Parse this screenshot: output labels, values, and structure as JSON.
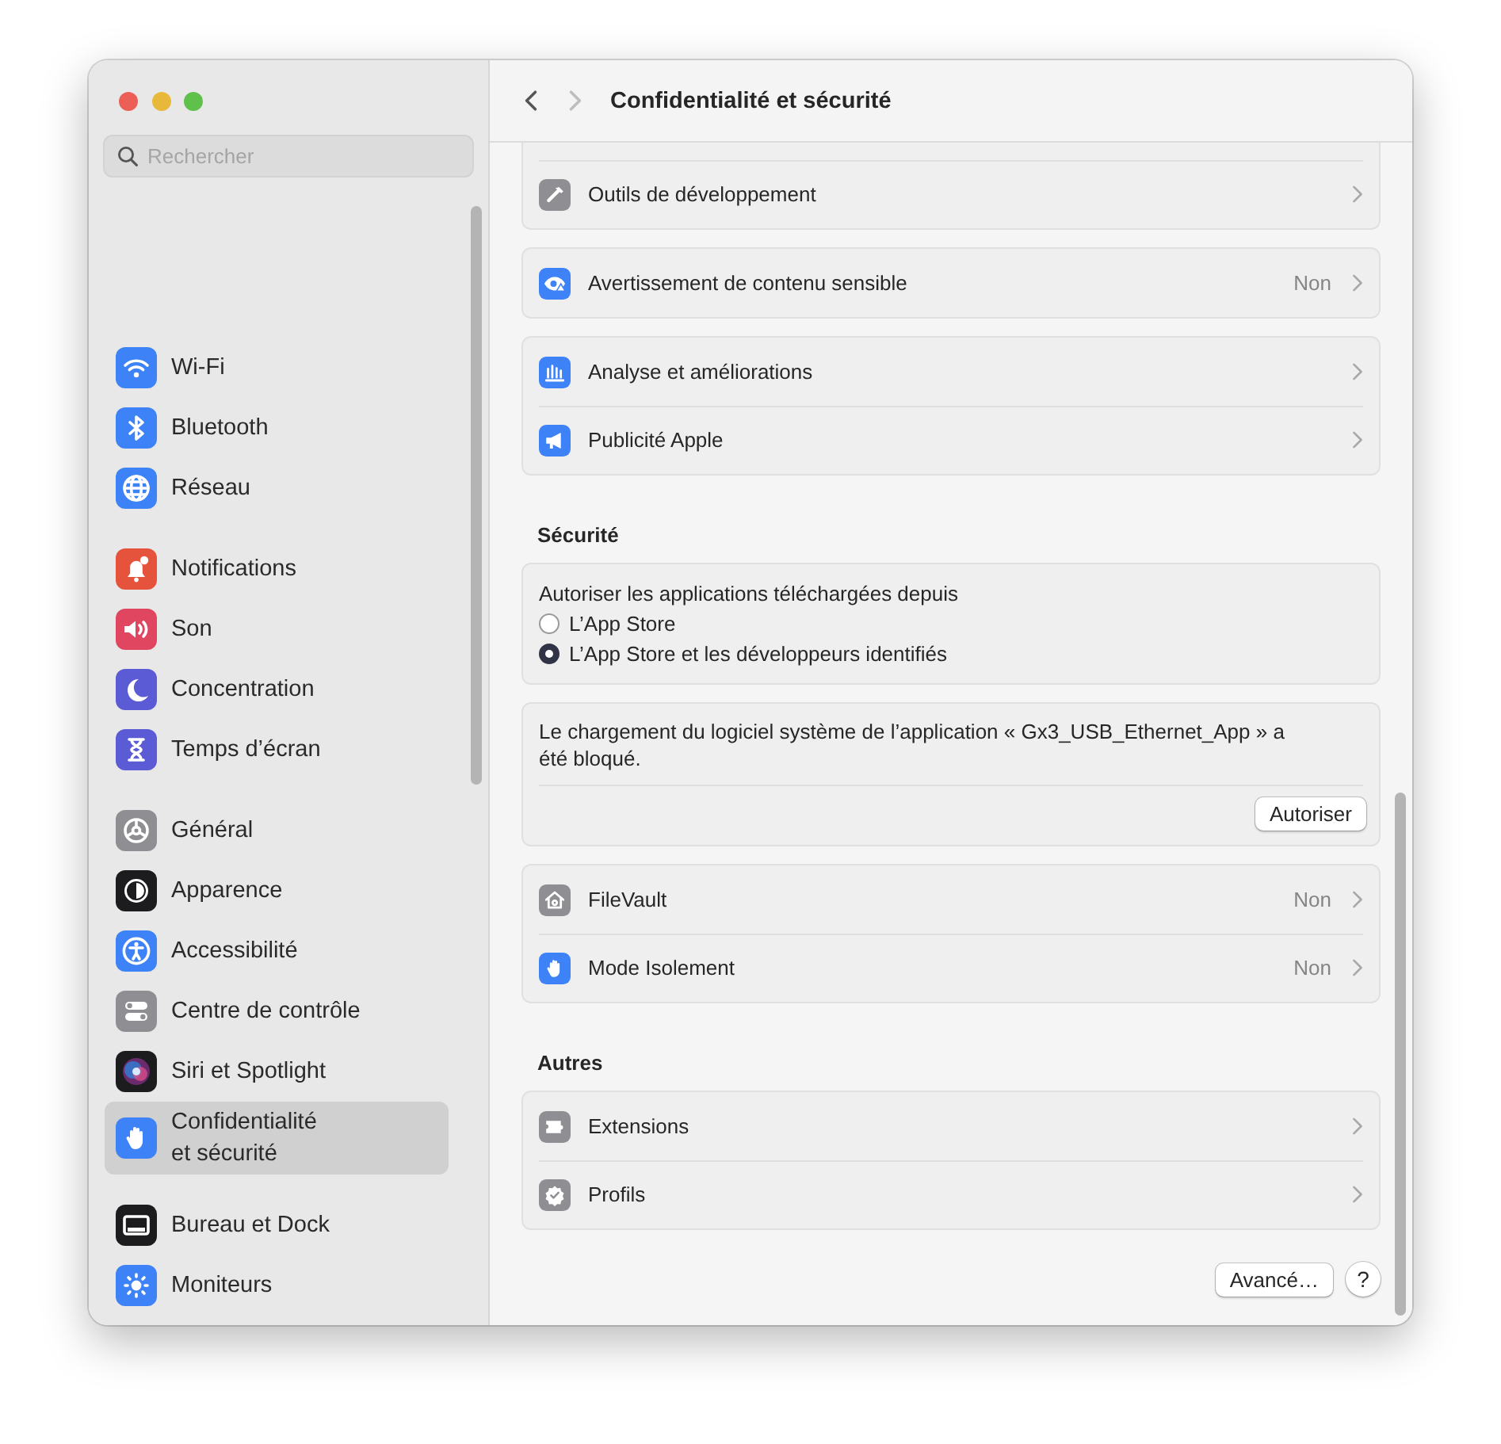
{
  "window": {
    "title": "Confidentialité et sécurité"
  },
  "navigation": {
    "back": {
      "disabled": false
    },
    "forward": {
      "disabled": true
    }
  },
  "sidebar": {
    "search": {
      "placeholder": "Rechercher"
    },
    "groups": [
      {
        "items": [
          {
            "label": "Wi-Fi",
            "selected": false
          },
          {
            "label": "Bluetooth",
            "selected": false
          },
          {
            "label": "Réseau",
            "selected": false
          }
        ]
      },
      {
        "items": [
          {
            "label": "Notifications",
            "selected": false
          },
          {
            "label": "Son",
            "selected": false
          },
          {
            "label": "Concentration",
            "selected": false
          },
          {
            "label": "Temps d’écran",
            "selected": false
          }
        ]
      },
      {
        "items": [
          {
            "label": "Général",
            "selected": false
          },
          {
            "label": "Apparence",
            "selected": false
          },
          {
            "label": "Accessibilité",
            "selected": false
          },
          {
            "label": "Centre de contrôle",
            "selected": false
          },
          {
            "label": "Siri et Spotlight",
            "selected": false
          },
          {
            "label": "Confidentialité\net sécurité",
            "selected": true
          }
        ]
      },
      {
        "items": [
          {
            "label": "Bureau et Dock",
            "selected": false
          },
          {
            "label": "Moniteurs",
            "selected": false
          }
        ]
      }
    ]
  },
  "content": {
    "sections": [
      {
        "cards": [
          {
            "kind": "list",
            "cut_off": true,
            "rows": [
              {
                "label": "Outils de développement"
              }
            ]
          },
          {
            "kind": "list",
            "rows": [
              {
                "label": "Avertissement de contenu sensible",
                "value": "Non"
              }
            ]
          },
          {
            "kind": "list",
            "rows": [
              {
                "label": "Analyse et améliorations"
              },
              {
                "label": "Publicité Apple"
              }
            ]
          }
        ]
      },
      {
        "heading": "Sécurité",
        "cards": [
          {
            "kind": "radios",
            "label": "Autoriser les applications téléchargées depuis",
            "options": [
              {
                "label": "L’App Store",
                "selected": false
              },
              {
                "label": "L’App Store et les développeurs identifiés",
                "selected": true
              }
            ]
          },
          {
            "kind": "message",
            "text": "Le chargement du logiciel système de l’application « Gx3_USB_Ethernet_App » a été bloqué.",
            "button": "Autoriser"
          },
          {
            "kind": "list",
            "rows": [
              {
                "label": "FileVault",
                "value": "Non"
              },
              {
                "label": "Mode Isolement",
                "value": "Non"
              }
            ]
          }
        ]
      },
      {
        "heading": "Autres",
        "cards": [
          {
            "kind": "list",
            "rows": [
              {
                "label": "Extensions"
              },
              {
                "label": "Profils"
              }
            ]
          }
        ]
      }
    ],
    "footer": {
      "buttons": [
        {
          "label": "Avancé…",
          "kind": "text"
        },
        {
          "label": "?",
          "kind": "help"
        }
      ]
    }
  }
}
